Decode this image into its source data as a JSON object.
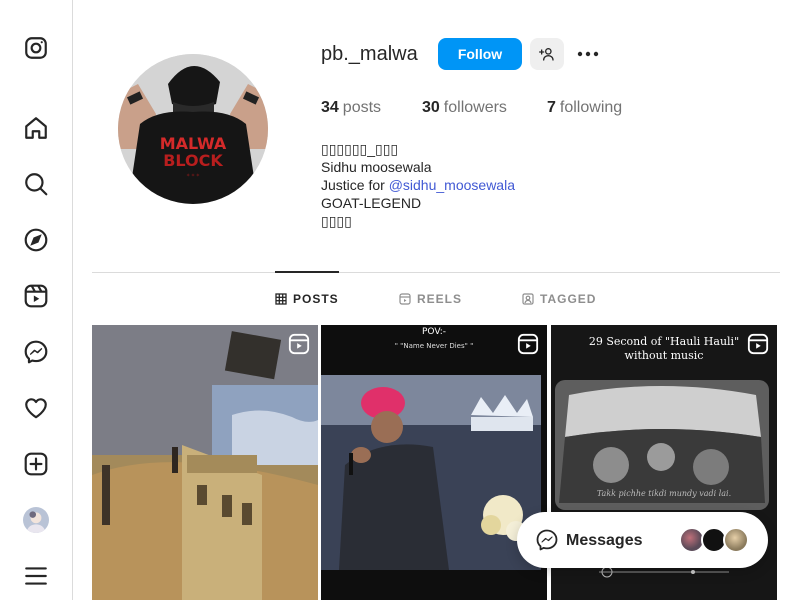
{
  "nav": {
    "items": [
      {
        "icon": "instagram-icon"
      },
      {
        "icon": "home-icon"
      },
      {
        "icon": "search-icon"
      },
      {
        "icon": "explore-icon"
      },
      {
        "icon": "reels-icon"
      },
      {
        "icon": "messenger-icon"
      },
      {
        "icon": "heart-icon"
      },
      {
        "icon": "create-icon"
      },
      {
        "icon": "profile-avatar"
      },
      {
        "icon": "menu-icon"
      }
    ]
  },
  "profile": {
    "username": "pb._malwa",
    "follow_label": "Follow",
    "stats": {
      "posts_count": "34",
      "posts_label": "posts",
      "followers_count": "30",
      "followers_label": "followers",
      "following_count": "7",
      "following_label": "following"
    },
    "bio": {
      "line1": "▯▯▯▯▯▯_▯▯▯",
      "line2": "Sidhu moosewala",
      "line3_prefix": "Justice for ",
      "line3_link": "@sidhu_moosewala",
      "line4": "GOAT-LEGEND",
      "line5": "▯▯▯▯"
    }
  },
  "tabs": [
    {
      "label": "POSTS",
      "active": true
    },
    {
      "label": "REELS",
      "active": false
    },
    {
      "label": "TAGGED",
      "active": false
    }
  ],
  "posts": {
    "post2_title": "POV:-",
    "post2_sub": "\" \"Name Never Dies\" \"",
    "post3_title": "29 Second of \"Hauli Hauli\" without music",
    "post3_caption": "Takk pichhe tikdi mundy vadi lai."
  },
  "messages": {
    "label": "Messages"
  },
  "colors": {
    "accent": "#0095f6",
    "link": "#4159d4",
    "text": "#262626",
    "muted": "#737373"
  }
}
